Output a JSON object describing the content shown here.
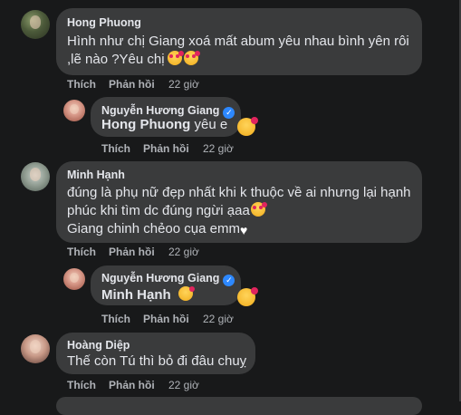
{
  "comments": [
    {
      "author": "Hong Phuong",
      "line1": "Hình như chị Giang xoá mất abum yêu nhau bình yên rôi",
      "line2": ",lẽ nào ?Yêu chị",
      "actions": {
        "like": "Thích",
        "reply": "Phản hồi",
        "time": "22 giờ"
      }
    },
    {
      "author": "Nguyễn Hương Giang",
      "mention": "Hong Phuong",
      "text": "yêu e",
      "actions": {
        "like": "Thích",
        "reply": "Phản hồi",
        "time": "22 giờ"
      }
    },
    {
      "author": "Minh Hạnh",
      "line1": "đúng là phụ nữ đẹp nhất khi k thuộc về ai nhưng lại hạnh",
      "line2": "phúc khi tìm dc đúng ngừi ạaa",
      "line3": "Giang chinh chẻoo cụa emm",
      "actions": {
        "like": "Thích",
        "reply": "Phản hồi",
        "time": "22 giờ"
      }
    },
    {
      "author": "Nguyễn Hương Giang",
      "mention": "Minh Hạnh",
      "actions": {
        "like": "Thích",
        "reply": "Phản hồi",
        "time": "22 giờ"
      }
    },
    {
      "author": "Hoàng Diệp",
      "text": "Thế còn Tú thì bỏ đi đâu chuỵ",
      "actions": {
        "like": "Thích",
        "reply": "Phản hồi",
        "time": "22 giờ"
      }
    }
  ],
  "colors": {
    "background": "#18191a",
    "bubble": "#3a3b3c",
    "text": "#e4e6eb",
    "secondary": "#b0b3b8",
    "verified": "#2d88ff"
  }
}
